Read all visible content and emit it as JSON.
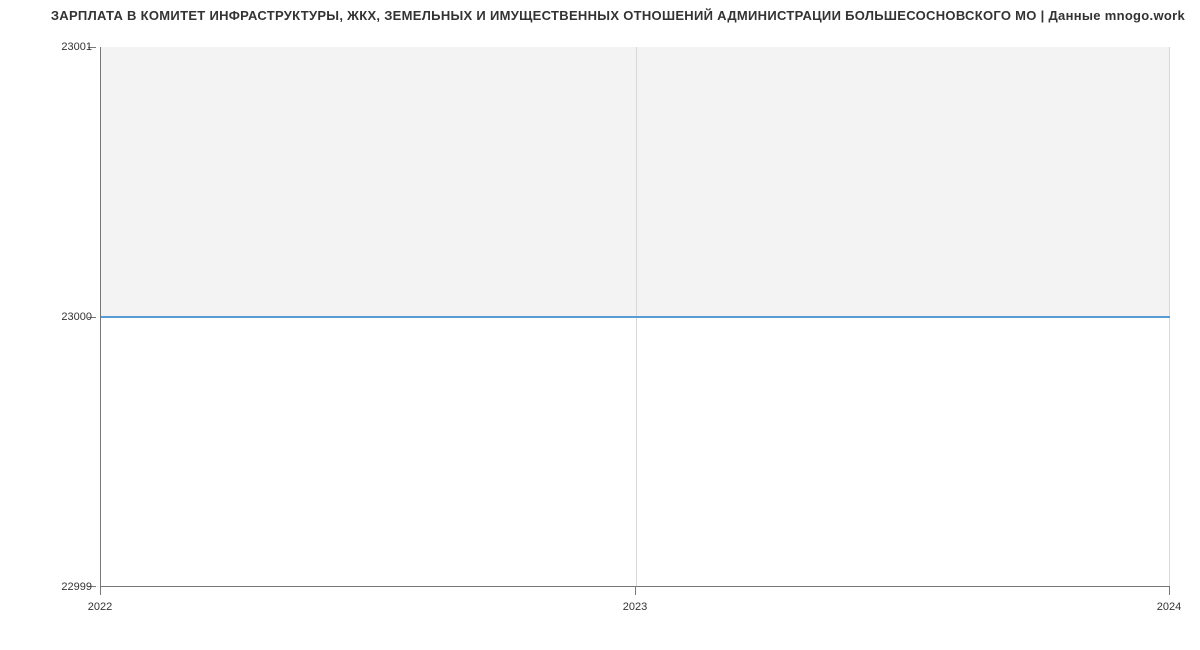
{
  "chart_data": {
    "type": "line",
    "title": "ЗАРПЛАТА В КОМИТЕТ ИНФРАСТРУКТУРЫ, ЖКХ, ЗЕМЕЛЬНЫХ И ИМУЩЕСТВЕННЫХ ОТНОШЕНИЙ АДМИНИСТРАЦИИ БОЛЬШЕСОСНОВСКОГО МО | Данные mnogo.work",
    "x": [
      2022,
      2023,
      2024
    ],
    "values": [
      23000,
      23000,
      23000
    ],
    "xlabel": "",
    "ylabel": "",
    "ylim": [
      22999,
      23001
    ],
    "y_ticks": [
      22999,
      23000,
      23001
    ],
    "x_ticks": [
      2022,
      2023,
      2024
    ],
    "line_color": "#5b9bd5"
  }
}
